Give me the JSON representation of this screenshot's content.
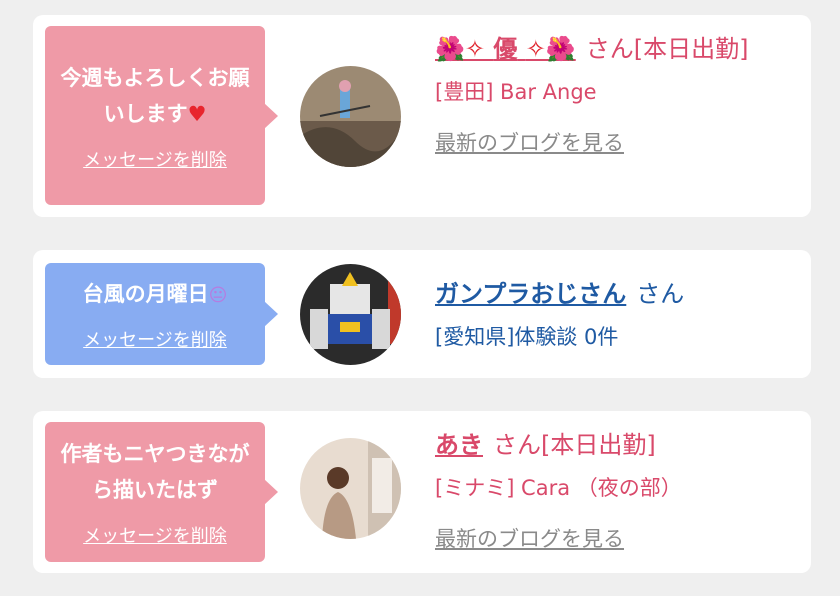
{
  "cards": [
    {
      "message": "今週もよろしくお願いします",
      "message_emoji": "♥",
      "delete_label": "メッセージを削除",
      "name": "優",
      "name_deco_left": "🌺✧",
      "name_deco_right": "✧🌺",
      "suffix": "さん[本日出勤]",
      "location": "[豊田] Bar Ange",
      "blog_label": "最新のブログを見る",
      "bubble_color": "#ef9aa7"
    },
    {
      "message": "台風の月曜日",
      "message_emoji": "😐",
      "delete_label": "メッセージを削除",
      "name": "ガンプラおじさん",
      "suffix": "さん",
      "location": "[愛知県]体験談 0件",
      "bubble_color": "#88acf2"
    },
    {
      "message": "作者もニヤつきながら描いたはず",
      "delete_label": "メッセージを削除",
      "name": "あき",
      "suffix": "さん[本日出勤]",
      "location": "[ミナミ] Cara （夜の部）",
      "blog_label": "最新のブログを見る",
      "bubble_color": "#ef9aa7"
    }
  ]
}
